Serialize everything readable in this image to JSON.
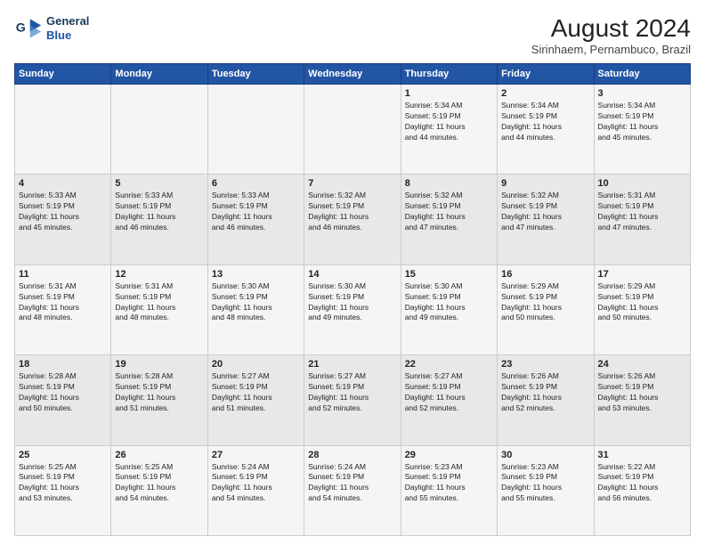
{
  "header": {
    "logo_line1": "General",
    "logo_line2": "Blue",
    "title": "August 2024",
    "subtitle": "Sirinhaem, Pernambuco, Brazil"
  },
  "days_of_week": [
    "Sunday",
    "Monday",
    "Tuesday",
    "Wednesday",
    "Thursday",
    "Friday",
    "Saturday"
  ],
  "weeks": [
    [
      {
        "day": "",
        "info": ""
      },
      {
        "day": "",
        "info": ""
      },
      {
        "day": "",
        "info": ""
      },
      {
        "day": "",
        "info": ""
      },
      {
        "day": "1",
        "info": "Sunrise: 5:34 AM\nSunset: 5:19 PM\nDaylight: 11 hours\nand 44 minutes."
      },
      {
        "day": "2",
        "info": "Sunrise: 5:34 AM\nSunset: 5:19 PM\nDaylight: 11 hours\nand 44 minutes."
      },
      {
        "day": "3",
        "info": "Sunrise: 5:34 AM\nSunset: 5:19 PM\nDaylight: 11 hours\nand 45 minutes."
      }
    ],
    [
      {
        "day": "4",
        "info": "Sunrise: 5:33 AM\nSunset: 5:19 PM\nDaylight: 11 hours\nand 45 minutes."
      },
      {
        "day": "5",
        "info": "Sunrise: 5:33 AM\nSunset: 5:19 PM\nDaylight: 11 hours\nand 46 minutes."
      },
      {
        "day": "6",
        "info": "Sunrise: 5:33 AM\nSunset: 5:19 PM\nDaylight: 11 hours\nand 46 minutes."
      },
      {
        "day": "7",
        "info": "Sunrise: 5:32 AM\nSunset: 5:19 PM\nDaylight: 11 hours\nand 46 minutes."
      },
      {
        "day": "8",
        "info": "Sunrise: 5:32 AM\nSunset: 5:19 PM\nDaylight: 11 hours\nand 47 minutes."
      },
      {
        "day": "9",
        "info": "Sunrise: 5:32 AM\nSunset: 5:19 PM\nDaylight: 11 hours\nand 47 minutes."
      },
      {
        "day": "10",
        "info": "Sunrise: 5:31 AM\nSunset: 5:19 PM\nDaylight: 11 hours\nand 47 minutes."
      }
    ],
    [
      {
        "day": "11",
        "info": "Sunrise: 5:31 AM\nSunset: 5:19 PM\nDaylight: 11 hours\nand 48 minutes."
      },
      {
        "day": "12",
        "info": "Sunrise: 5:31 AM\nSunset: 5:19 PM\nDaylight: 11 hours\nand 48 minutes."
      },
      {
        "day": "13",
        "info": "Sunrise: 5:30 AM\nSunset: 5:19 PM\nDaylight: 11 hours\nand 48 minutes."
      },
      {
        "day": "14",
        "info": "Sunrise: 5:30 AM\nSunset: 5:19 PM\nDaylight: 11 hours\nand 49 minutes."
      },
      {
        "day": "15",
        "info": "Sunrise: 5:30 AM\nSunset: 5:19 PM\nDaylight: 11 hours\nand 49 minutes."
      },
      {
        "day": "16",
        "info": "Sunrise: 5:29 AM\nSunset: 5:19 PM\nDaylight: 11 hours\nand 50 minutes."
      },
      {
        "day": "17",
        "info": "Sunrise: 5:29 AM\nSunset: 5:19 PM\nDaylight: 11 hours\nand 50 minutes."
      }
    ],
    [
      {
        "day": "18",
        "info": "Sunrise: 5:28 AM\nSunset: 5:19 PM\nDaylight: 11 hours\nand 50 minutes."
      },
      {
        "day": "19",
        "info": "Sunrise: 5:28 AM\nSunset: 5:19 PM\nDaylight: 11 hours\nand 51 minutes."
      },
      {
        "day": "20",
        "info": "Sunrise: 5:27 AM\nSunset: 5:19 PM\nDaylight: 11 hours\nand 51 minutes."
      },
      {
        "day": "21",
        "info": "Sunrise: 5:27 AM\nSunset: 5:19 PM\nDaylight: 11 hours\nand 52 minutes."
      },
      {
        "day": "22",
        "info": "Sunrise: 5:27 AM\nSunset: 5:19 PM\nDaylight: 11 hours\nand 52 minutes."
      },
      {
        "day": "23",
        "info": "Sunrise: 5:26 AM\nSunset: 5:19 PM\nDaylight: 11 hours\nand 52 minutes."
      },
      {
        "day": "24",
        "info": "Sunrise: 5:26 AM\nSunset: 5:19 PM\nDaylight: 11 hours\nand 53 minutes."
      }
    ],
    [
      {
        "day": "25",
        "info": "Sunrise: 5:25 AM\nSunset: 5:19 PM\nDaylight: 11 hours\nand 53 minutes."
      },
      {
        "day": "26",
        "info": "Sunrise: 5:25 AM\nSunset: 5:19 PM\nDaylight: 11 hours\nand 54 minutes."
      },
      {
        "day": "27",
        "info": "Sunrise: 5:24 AM\nSunset: 5:19 PM\nDaylight: 11 hours\nand 54 minutes."
      },
      {
        "day": "28",
        "info": "Sunrise: 5:24 AM\nSunset: 5:19 PM\nDaylight: 11 hours\nand 54 minutes."
      },
      {
        "day": "29",
        "info": "Sunrise: 5:23 AM\nSunset: 5:19 PM\nDaylight: 11 hours\nand 55 minutes."
      },
      {
        "day": "30",
        "info": "Sunrise: 5:23 AM\nSunset: 5:19 PM\nDaylight: 11 hours\nand 55 minutes."
      },
      {
        "day": "31",
        "info": "Sunrise: 5:22 AM\nSunset: 5:19 PM\nDaylight: 11 hours\nand 56 minutes."
      }
    ]
  ]
}
